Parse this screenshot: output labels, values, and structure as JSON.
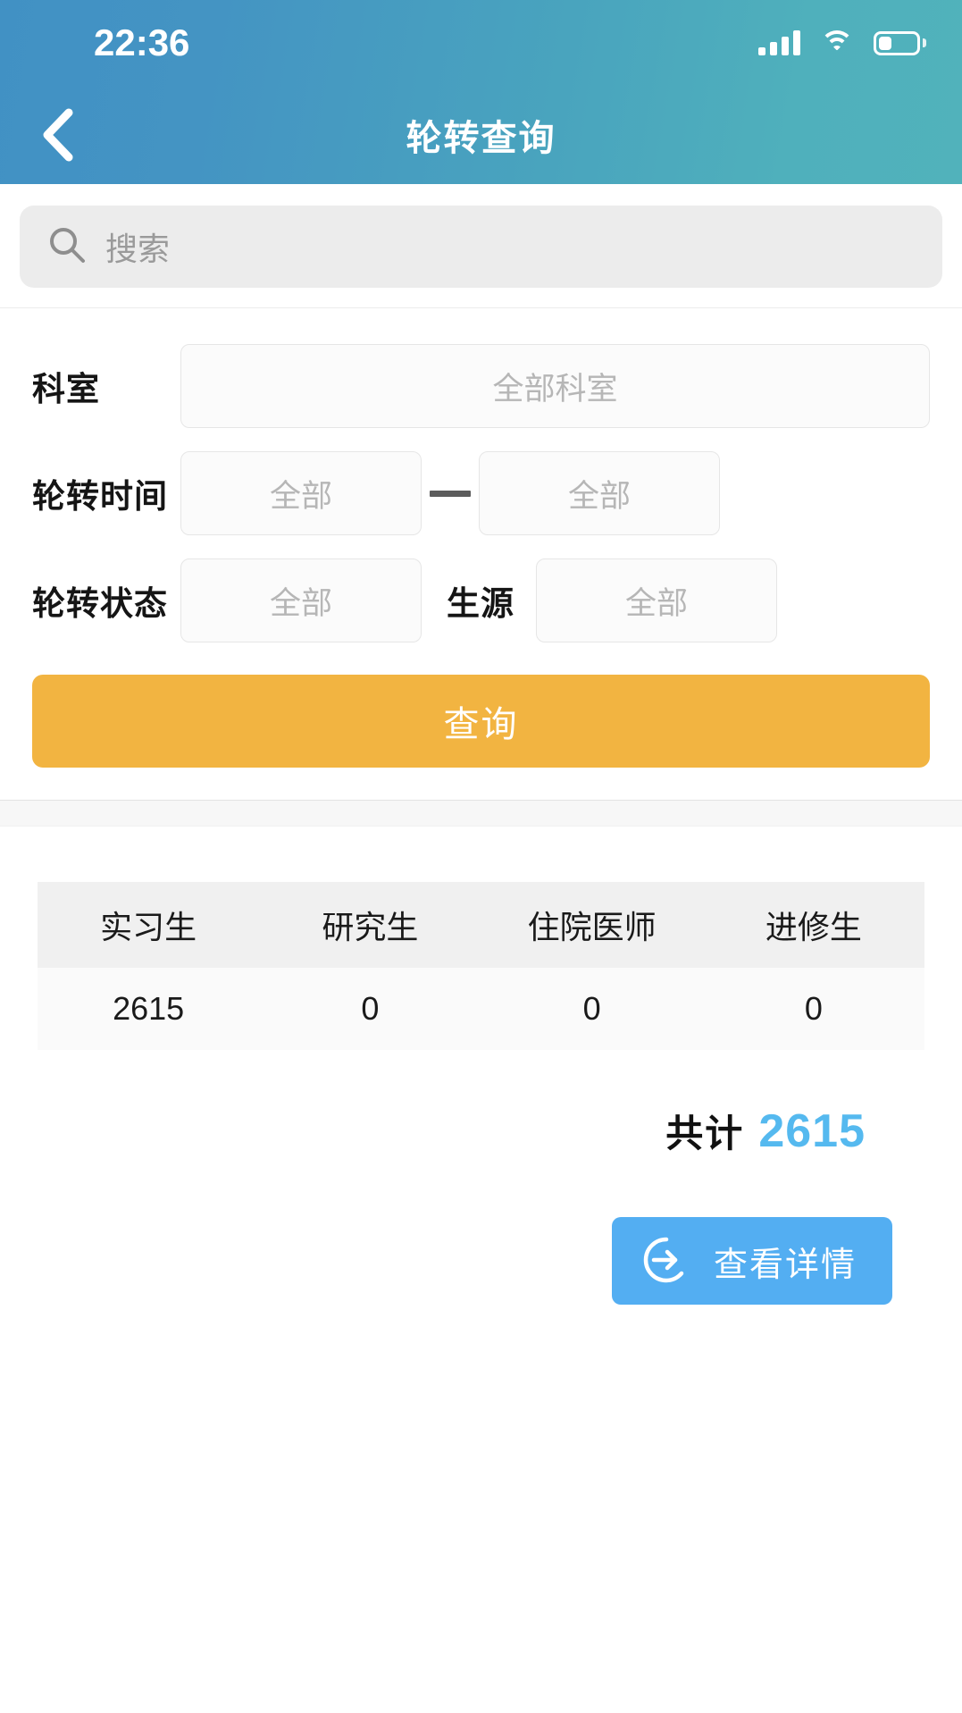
{
  "status_bar": {
    "time": "22:36",
    "signal_icon": "signal-bars-icon",
    "wifi_icon": "wifi-icon",
    "battery_icon": "battery-icon",
    "battery_level_pct": 35
  },
  "nav": {
    "title": "轮转查询",
    "back_icon": "chevron-left-icon"
  },
  "search": {
    "icon": "search-icon",
    "placeholder": "搜索",
    "value": ""
  },
  "filters": {
    "department": {
      "label": "科室",
      "value": "全部科室"
    },
    "rotation_time": {
      "label": "轮转时间",
      "start_value": "全部",
      "end_value": "全部",
      "separator": "—"
    },
    "rotation_status": {
      "label": "轮转状态",
      "value": "全部"
    },
    "student_source": {
      "label": "生源",
      "value": "全部"
    },
    "submit_label": "查询"
  },
  "results": {
    "columns": [
      "实习生",
      "研究生",
      "住院医师",
      "进修生"
    ],
    "row": [
      "2615",
      "0",
      "0",
      "0"
    ],
    "total_label": "共计",
    "total_value": "2615",
    "detail_button": {
      "label": "查看详情",
      "icon": "arrow-right-circle-icon"
    }
  },
  "colors": {
    "header_start": "#4191c4",
    "header_end": "#51b2bb",
    "accent_orange": "#f2b441",
    "accent_blue": "#53aef2",
    "total_blue": "#55b9ef"
  }
}
